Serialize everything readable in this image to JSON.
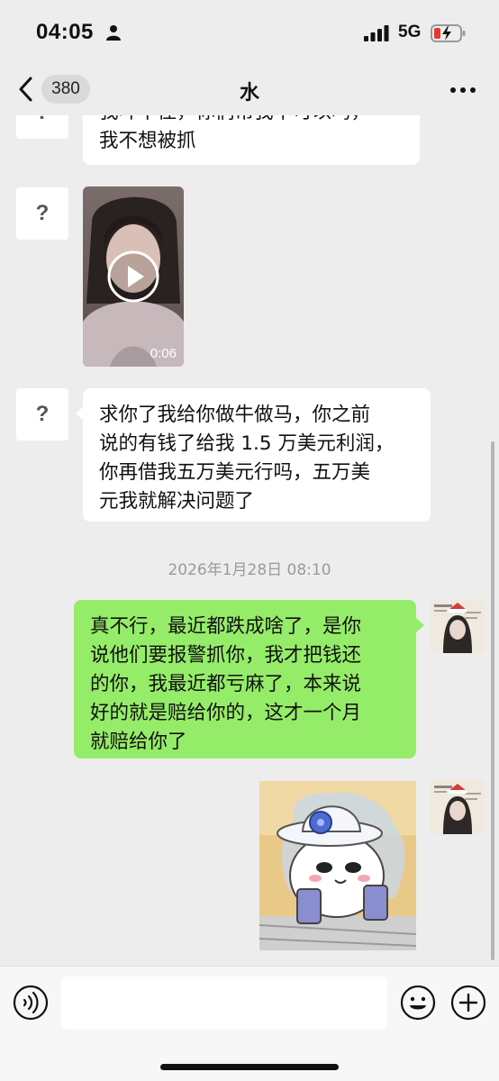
{
  "status_bar": {
    "time": "04:05",
    "network": "5G",
    "icons": [
      "person-icon",
      "signal-icon",
      "battery-charging-icon"
    ]
  },
  "nav": {
    "unread_count": "380",
    "title": "水",
    "icons": [
      "chevron-left-icon",
      "more-icon"
    ]
  },
  "messages": [
    {
      "id": "m1",
      "direction": "incoming",
      "type": "text",
      "avatar": "?",
      "lines": [
        "我斗不住，你们帮我不可以吗，",
        "我不想被抓"
      ]
    },
    {
      "id": "m2",
      "direction": "incoming",
      "type": "video",
      "avatar": "?",
      "duration": "0:06"
    },
    {
      "id": "m3",
      "direction": "incoming",
      "type": "text",
      "avatar": "?",
      "lines": [
        "求你了我给你做牛做马，你之前",
        "说的有钱了给我 1.5 万美元利润，",
        "你再借我五万美元行吗，五万美",
        "元我就解决问题了"
      ]
    },
    {
      "id": "ts1",
      "type": "timestamp",
      "text": "2026年1月28日 08:10"
    },
    {
      "id": "m4",
      "direction": "outgoing",
      "type": "text",
      "lines": [
        "真不行，最近都跌成啥了，是你",
        "说他们要报警抓你，我才把钱还",
        "的你，我最近都亏麻了，本来说",
        "好的就是赔给你的，这才一个月",
        "就赔给你了"
      ]
    },
    {
      "id": "m5",
      "direction": "outgoing",
      "type": "sticker",
      "sticker_icon": "hamster-with-hat-sticker"
    }
  ],
  "input_bar": {
    "value": "",
    "placeholder": "",
    "icons": [
      "voice-icon",
      "emoji-icon",
      "plus-icon"
    ]
  },
  "colors": {
    "background": "#ededed",
    "outgoing_bubble": "#95ec69",
    "incoming_bubble": "#ffffff",
    "timestamp": "#9a9a9a"
  }
}
